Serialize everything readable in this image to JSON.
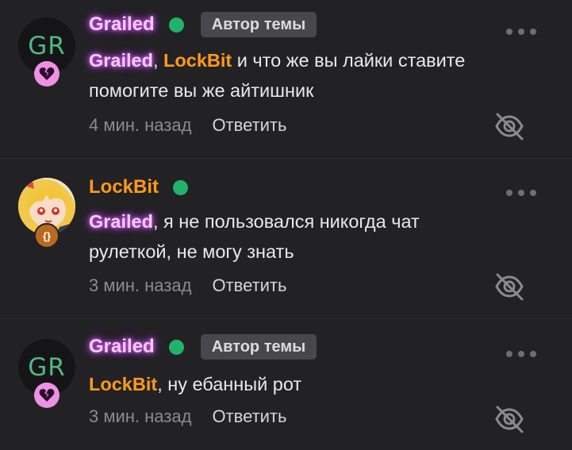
{
  "comments": [
    {
      "author": "Grailed",
      "avatar_initials": "GR",
      "author_tag": "Автор темы",
      "text_mentions": [
        "Grailed",
        "LockBit"
      ],
      "text_sep": ",",
      "text_rest": " и что же вы лайки ставите помогите вы же айтишник",
      "time": "4 мин. назад",
      "reply_label": "Ответить",
      "badge_icon": "broken-heart-icon"
    },
    {
      "author": "LockBit",
      "avatar_initials": "",
      "author_tag": "",
      "text_mentions": [
        "Grailed"
      ],
      "text_rest": ", я не пользовался никогда чат рулеткой, не могу знать",
      "time": "3 мин. назад",
      "reply_label": "Ответить",
      "badge_text": "{}",
      "badge_icon": "code-braces-icon"
    },
    {
      "author": "Grailed",
      "avatar_initials": "GR",
      "author_tag": "Автор темы",
      "text_mentions": [
        "LockBit"
      ],
      "text_rest": ", ну ебанный рот",
      "time": "3 мин. назад",
      "reply_label": "Ответить",
      "badge_icon": "broken-heart-icon"
    }
  ],
  "colors": {
    "background": "#222224",
    "glow_name": "#f6ccf4",
    "orange_name": "#ff9a1a",
    "online": "#21b36a",
    "avatar_initials": "#52b786"
  }
}
